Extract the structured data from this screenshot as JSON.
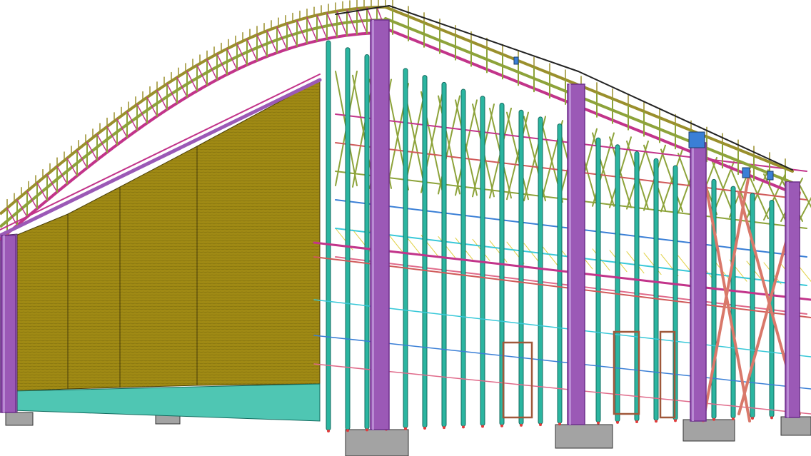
{
  "scene": {
    "description_visible_text": "",
    "palette": {
      "background": "#ffffff",
      "column_main": "#9b59b6",
      "column_main_dark": "#6c2f8c",
      "column_secondary": "#2bb5a0",
      "column_secondary_dark": "#136b5f",
      "truss_green": "#8da33a",
      "truss_olive": "#9a8f2c",
      "truss_magenta": "#c2348a",
      "beam_red": "#d05a5a",
      "beam_pink": "#e06a8a",
      "bracing_salmon": "#d9786a",
      "cladding_face": "#a08a14",
      "cladding_line": "#7a6a0e",
      "base_panels": "#4fc6b3",
      "footing": "#a3a3a3",
      "outline": "#222222",
      "anchor_red": "#e23a3a",
      "brown_frame": "#a0583a",
      "blue_line": "#3a7fd6",
      "cyan_line": "#38c8d8",
      "yellow_line": "#e0d040"
    }
  }
}
